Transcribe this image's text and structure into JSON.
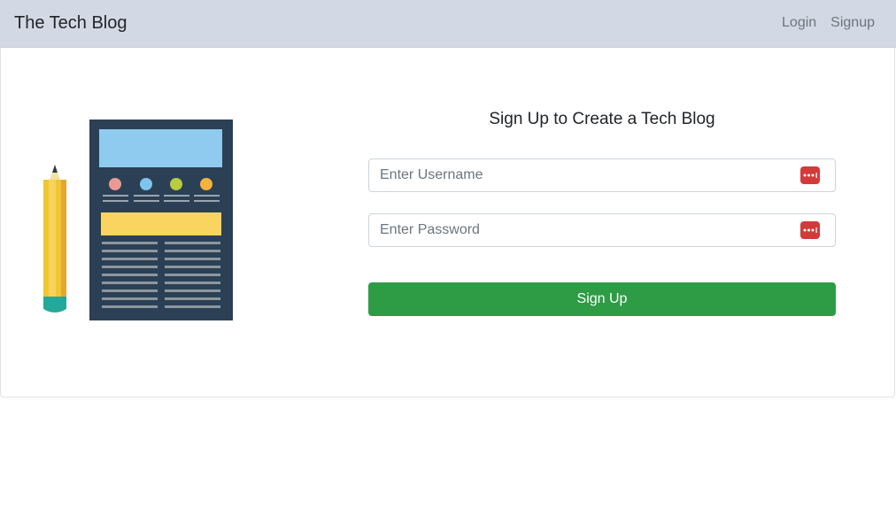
{
  "navbar": {
    "brand": "The Tech Blog",
    "links": [
      {
        "label": "Login"
      },
      {
        "label": "Signup"
      }
    ]
  },
  "form": {
    "title": "Sign Up to Create a Tech Blog",
    "username": {
      "value": "",
      "placeholder": "Enter Username"
    },
    "password": {
      "value": "",
      "placeholder": "Enter Password"
    },
    "submit_label": "Sign Up"
  },
  "icons": {
    "password_manager": "password-manager-icon",
    "illustration": "pencil-and-document-illustration"
  },
  "colors": {
    "navbar_bg": "#d3d9e4",
    "button_bg": "#2d9c44",
    "password_icon_bg": "#d33a3a"
  }
}
